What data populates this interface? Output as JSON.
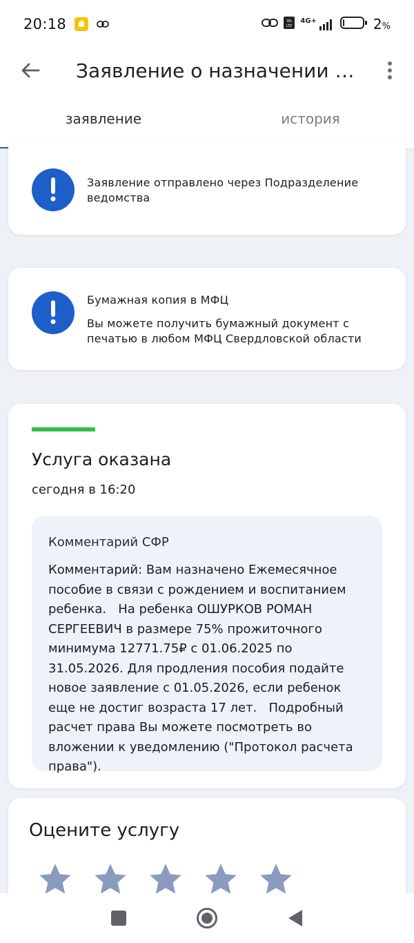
{
  "status_bar": {
    "time": "20:18",
    "network": "4G+",
    "battery_pct": "2",
    "battery_unit": "%"
  },
  "appbar": {
    "title": "Заявление о назначении ежемесячного пособия",
    "back_icon": "arrow-left-icon",
    "more_icon": "more-vertical-icon"
  },
  "tabs": [
    {
      "label": "заявление",
      "active": true
    },
    {
      "label": "история",
      "active": false
    }
  ],
  "notices": [
    {
      "text": "Заявление отправлено через Подразделение ведомства"
    },
    {
      "title": "Бумажная копия в МФЦ",
      "text": "Вы можете получить бумажный документ с печатью в любом МФЦ Свердловской области"
    }
  ],
  "status": {
    "title": "Услуга оказана",
    "time": "сегодня в 16:20",
    "accent_color": "#2fbf4a"
  },
  "comment": {
    "title": "Комментарий СФР",
    "body": "Комментарий: Вам назначено Ежемесячное пособие в связи с рождением и воспитанием ребенка.   На ребенка ОШУРКОВ РОМАН СЕРГЕЕВИЧ в размере 75% прожиточного минимума 12771.75₽ с 01.06.2025 по 31.05.2026. Для продления пособия подайте новое заявление с 01.05.2026, если ребенок еще не достиг возраста 17 лет.   Подробный расчет права Вы можете посмотреть во вложении к уведомлению (\"Протокол расчета права\")."
  },
  "rating": {
    "title": "Оцените услугу",
    "stars_total": 5,
    "stars_selected": 0
  },
  "colors": {
    "primary": "#1d5ec9",
    "tab_indicator": "#1f5fbf",
    "star": "#8a9bbf"
  }
}
